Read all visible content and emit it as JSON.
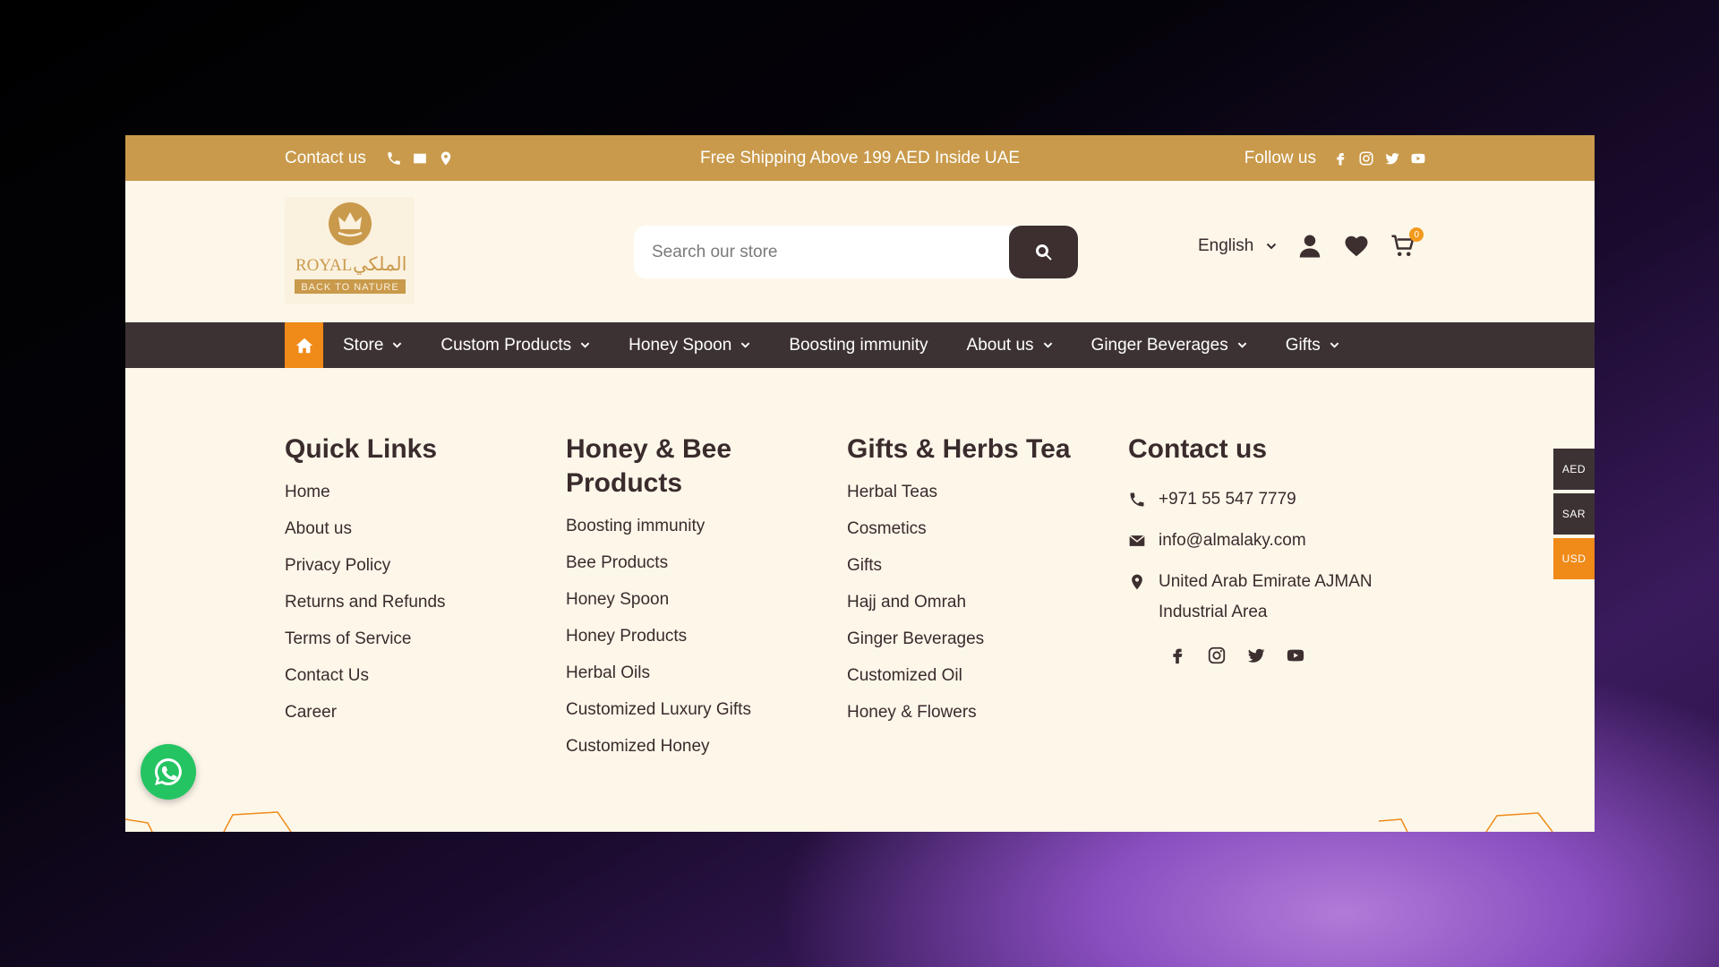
{
  "topbar": {
    "contact_label": "Contact us",
    "shipping_text": "Free Shipping Above 199 AED Inside UAE",
    "follow_label": "Follow us"
  },
  "header": {
    "logo_text_top": "ROYAL",
    "logo_text_arabic": "الملكي",
    "logo_tagline": "BACK TO NATURE",
    "search_placeholder": "Search our store",
    "language": "English",
    "cart_count": "0"
  },
  "nav": {
    "items": [
      {
        "label": "Store",
        "dropdown": true
      },
      {
        "label": "Custom Products",
        "dropdown": true
      },
      {
        "label": "Honey Spoon",
        "dropdown": true
      },
      {
        "label": "Boosting immunity",
        "dropdown": false
      },
      {
        "label": "About us",
        "dropdown": true
      },
      {
        "label": "Ginger Beverages",
        "dropdown": true
      },
      {
        "label": "Gifts",
        "dropdown": true
      }
    ]
  },
  "footer": {
    "quick_links": {
      "title": "Quick Links",
      "items": [
        "Home",
        "About us",
        "Privacy Policy",
        "Returns and Refunds",
        "Terms of Service",
        "Contact Us",
        "Career"
      ]
    },
    "honey_bee": {
      "title": "Honey & Bee Products",
      "items": [
        "Boosting immunity",
        "Bee Products",
        "Honey Spoon",
        "Honey Products",
        "Herbal Oils",
        "Customized Luxury Gifts",
        "Customized Honey"
      ]
    },
    "gifts_herbs": {
      "title": "Gifts & Herbs Tea",
      "items": [
        "Herbal Teas",
        "Cosmetics",
        "Gifts",
        "Hajj and Omrah",
        "Ginger Beverages",
        "Customized Oil",
        "Honey & Flowers"
      ]
    },
    "contact": {
      "title": "Contact us",
      "phone": "+971 55 547 7779",
      "email": "info@almalaky.com",
      "address_line1": "United Arab Emirate AJMAN",
      "address_line2": "Industrial Area"
    }
  },
  "currencies": [
    {
      "code": "AED",
      "active": false
    },
    {
      "code": "SAR",
      "active": false
    },
    {
      "code": "USD",
      "active": true
    }
  ],
  "colors": {
    "topbar": "#c99a4b",
    "nav": "#3d3233",
    "accent": "#f08a18",
    "page_bg": "#fdf7ea",
    "text": "#3a2b2c",
    "whatsapp": "#25c463"
  },
  "icons": [
    "phone-icon",
    "mail-icon",
    "location-icon",
    "facebook-icon",
    "instagram-icon",
    "twitter-icon",
    "youtube-icon",
    "search-icon",
    "user-icon",
    "heart-icon",
    "cart-icon",
    "home-icon",
    "whatsapp-icon"
  ]
}
